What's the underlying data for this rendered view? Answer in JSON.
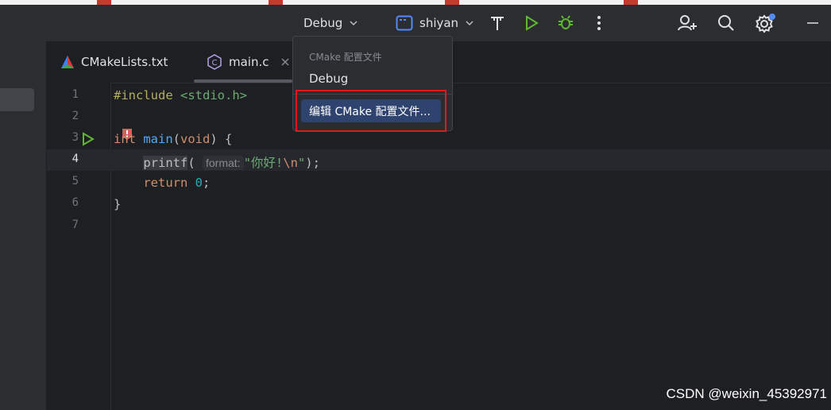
{
  "toolbar": {
    "config_label": "Debug",
    "target_label": "shiyan"
  },
  "tabs": [
    {
      "label": "CMakeLists.txt"
    },
    {
      "label": "main.c"
    }
  ],
  "editor": {
    "line_numbers": [
      "1",
      "2",
      "3",
      "4",
      "5",
      "6",
      "7"
    ],
    "hint_label": "format:"
  },
  "dropdown": {
    "header": "CMake 配置文件",
    "item": "Debug",
    "action": "编辑 CMake 配置文件..."
  },
  "watermark": "CSDN @weixin_45392971",
  "colors": {
    "accent": "#2e436e",
    "run": "#5fb832",
    "highlight_border": "#e0191e"
  }
}
